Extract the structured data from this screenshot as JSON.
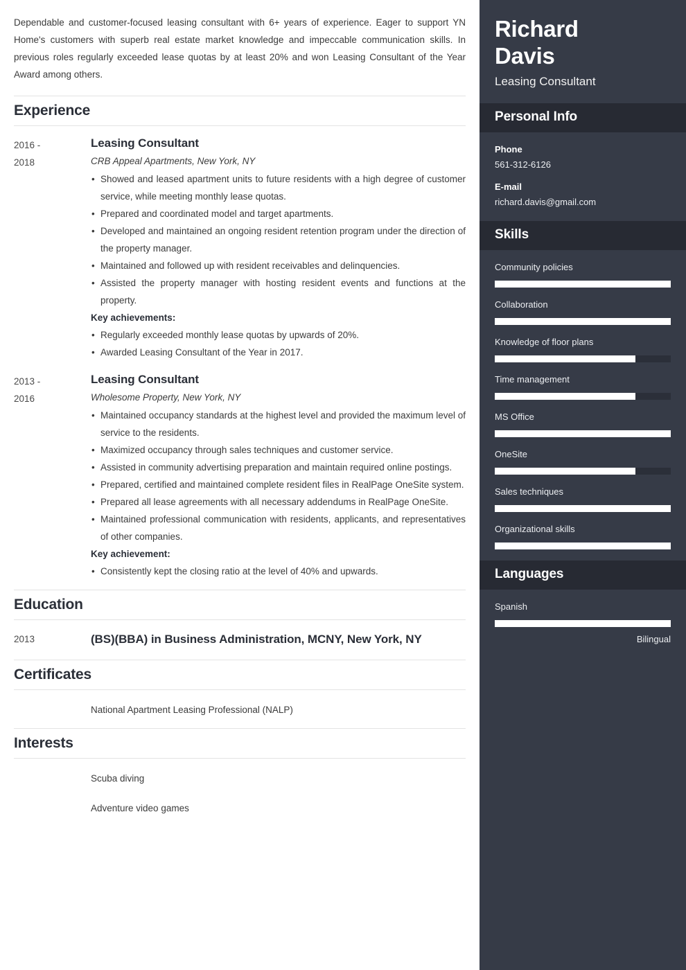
{
  "colors": {
    "sidebar_bg": "#363b47",
    "sidebar_band": "#272a33",
    "bar_fill": "#ffffff",
    "bar_track": "#2b2f39",
    "heading": "#2b2f38",
    "body_text": "#3b3b3b"
  },
  "main": {
    "summary": "Dependable and customer-focused leasing consultant with 6+ years of experience. Eager to support YN Home's customers with superb real estate market knowledge and impeccable communication skills. In previous roles regularly exceeded lease quotas by at least 20% and won Leasing Consultant of the Year Award among others.",
    "experience": {
      "title": "Experience",
      "entries": [
        {
          "date": "2016 - 2018",
          "date_line1": "2016 -",
          "date_line2": "2018",
          "job_title": "Leasing Consultant",
          "company": "CRB Appeal Apartments, New York, NY",
          "bullets": [
            "Showed and leased apartment units to future residents with a high degree of customer service, while meeting monthly lease quotas.",
            "Prepared and coordinated model and target apartments.",
            "Developed and maintained an ongoing resident retention program under the direction of the property manager.",
            "Maintained and followed up with resident receivables and delinquencies.",
            "Assisted the property manager with hosting resident events and functions at the property."
          ],
          "achievements_label": "Key achievements:",
          "achievements": [
            "Regularly exceeded monthly lease quotas by upwards of 20%.",
            "Awarded Leasing Consultant of the Year in 2017."
          ]
        },
        {
          "date": "2013 - 2016",
          "date_line1": "2013 -",
          "date_line2": "2016",
          "job_title": "Leasing Consultant",
          "company": "Wholesome Property, New York, NY",
          "bullets": [
            "Maintained occupancy standards at the highest level and provided the maximum level of service to the residents.",
            "Maximized occupancy through sales techniques and customer service.",
            "Assisted in community advertising preparation and maintain required online postings.",
            "Prepared, certified and maintained complete resident files in RealPage OneSite system.",
            "Prepared all lease agreements with all necessary addendums in RealPage OneSite.",
            "Maintained professional communication with residents, applicants, and representatives of other companies."
          ],
          "achievements_label": "Key achievement:",
          "achievements": [
            "Consistently kept the closing ratio at the level of 40% and upwards."
          ]
        }
      ]
    },
    "education": {
      "title": "Education",
      "entries": [
        {
          "date": "2013",
          "degree": "(BS)(BBA) in Business Administration,  MCNY, New York, NY"
        }
      ]
    },
    "certificates": {
      "title": "Certificates",
      "items": [
        {
          "date": "",
          "text": "National Apartment Leasing Professional (NALP)"
        }
      ]
    },
    "interests": {
      "title": "Interests",
      "items": [
        {
          "date": "",
          "text": "Scuba diving"
        },
        {
          "date": "",
          "text": "Adventure video games"
        }
      ]
    }
  },
  "sidebar": {
    "name": "Richard Davis",
    "name_line1": "Richard",
    "name_line2": "Davis",
    "role": "Leasing Consultant",
    "personal_info": {
      "title": "Personal Info",
      "fields": [
        {
          "label": "Phone",
          "value": "561-312-6126"
        },
        {
          "label": "E-mail",
          "value": "richard.davis@gmail.com"
        }
      ]
    },
    "skills": {
      "title": "Skills",
      "items": [
        {
          "name": "Community policies",
          "level": 100
        },
        {
          "name": "Collaboration",
          "level": 100
        },
        {
          "name": "Knowledge of floor plans",
          "level": 80
        },
        {
          "name": "Time management",
          "level": 80
        },
        {
          "name": "MS Office",
          "level": 100
        },
        {
          "name": "OneSite",
          "level": 80
        },
        {
          "name": "Sales techniques",
          "level": 100
        },
        {
          "name": "Organizational skills",
          "level": 100
        }
      ]
    },
    "languages": {
      "title": "Languages",
      "items": [
        {
          "name": "Spanish",
          "level": 100,
          "level_label": "Bilingual"
        }
      ]
    }
  }
}
